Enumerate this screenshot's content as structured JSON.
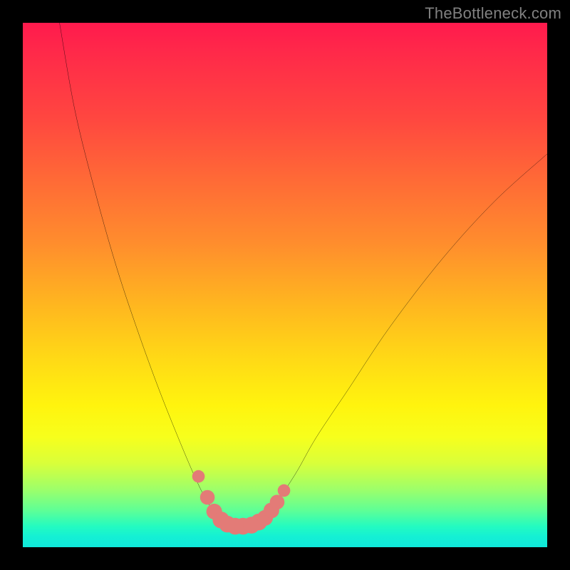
{
  "watermark": "TheBottleneck.com",
  "chart_data": {
    "type": "line",
    "title": "",
    "xlabel": "",
    "ylabel": "",
    "xlim": [
      0,
      100
    ],
    "ylim": [
      0,
      100
    ],
    "grid": false,
    "legend": false,
    "series": [
      {
        "name": "bottleneck-curve",
        "x": [
          7,
          10,
          14,
          18,
          22,
          26,
          30,
          33,
          35,
          37,
          38.5,
          40,
          42,
          44,
          46,
          48,
          52,
          56,
          62,
          70,
          80,
          90,
          100
        ],
        "y": [
          100,
          83,
          67,
          53,
          41,
          30,
          20,
          13,
          9,
          6,
          4.5,
          4,
          4,
          4.2,
          5.5,
          8,
          14,
          21,
          30,
          42,
          55,
          66,
          75
        ],
        "color": "#000000"
      }
    ],
    "markers": {
      "name": "sweet-spot-dots",
      "color": "#e37b77",
      "points": [
        {
          "x": 33.5,
          "y": 13.5,
          "r": 1.2
        },
        {
          "x": 35.2,
          "y": 9.5,
          "r": 1.4
        },
        {
          "x": 36.5,
          "y": 6.8,
          "r": 1.5
        },
        {
          "x": 37.8,
          "y": 5.2,
          "r": 1.6
        },
        {
          "x": 39.0,
          "y": 4.4,
          "r": 1.6
        },
        {
          "x": 40.5,
          "y": 4.0,
          "r": 1.6
        },
        {
          "x": 42.0,
          "y": 4.0,
          "r": 1.6
        },
        {
          "x": 43.6,
          "y": 4.2,
          "r": 1.6
        },
        {
          "x": 45.0,
          "y": 4.8,
          "r": 1.6
        },
        {
          "x": 46.2,
          "y": 5.6,
          "r": 1.5
        },
        {
          "x": 47.4,
          "y": 7.0,
          "r": 1.5
        },
        {
          "x": 48.5,
          "y": 8.6,
          "r": 1.4
        },
        {
          "x": 49.8,
          "y": 10.8,
          "r": 1.2
        }
      ]
    }
  }
}
